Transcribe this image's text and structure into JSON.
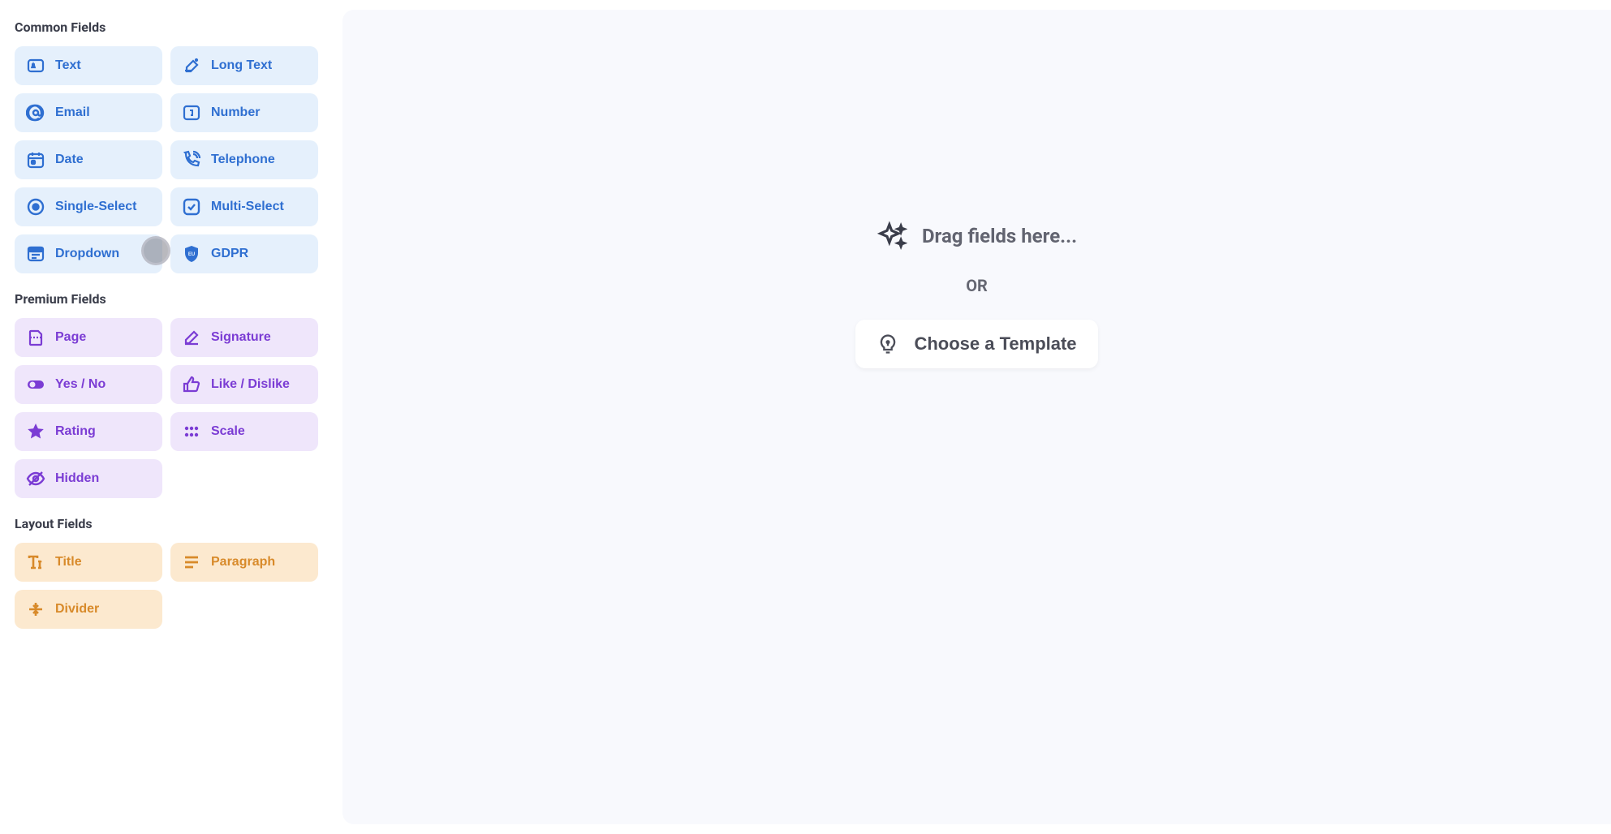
{
  "sections": {
    "common": {
      "title": "Common Fields",
      "items": [
        {
          "label": "Text",
          "icon": "text"
        },
        {
          "label": "Long Text",
          "icon": "longtext"
        },
        {
          "label": "Email",
          "icon": "email"
        },
        {
          "label": "Number",
          "icon": "number"
        },
        {
          "label": "Date",
          "icon": "date"
        },
        {
          "label": "Telephone",
          "icon": "telephone"
        },
        {
          "label": "Single-Select",
          "icon": "singleselect"
        },
        {
          "label": "Multi-Select",
          "icon": "multiselect"
        },
        {
          "label": "Dropdown",
          "icon": "dropdown"
        },
        {
          "label": "GDPR",
          "icon": "gdpr"
        }
      ]
    },
    "premium": {
      "title": "Premium Fields",
      "items": [
        {
          "label": "Page",
          "icon": "page"
        },
        {
          "label": "Signature",
          "icon": "signature"
        },
        {
          "label": "Yes / No",
          "icon": "yesno"
        },
        {
          "label": "Like / Dislike",
          "icon": "likedislike"
        },
        {
          "label": "Rating",
          "icon": "rating"
        },
        {
          "label": "Scale",
          "icon": "scale"
        },
        {
          "label": "Hidden",
          "icon": "hidden"
        }
      ]
    },
    "layout": {
      "title": "Layout Fields",
      "items": [
        {
          "label": "Title",
          "icon": "title"
        },
        {
          "label": "Paragraph",
          "icon": "paragraph"
        },
        {
          "label": "Divider",
          "icon": "divider"
        }
      ]
    }
  },
  "canvas": {
    "drag_hint": "Drag fields here...",
    "or": "OR",
    "template_btn": "Choose a Template"
  }
}
